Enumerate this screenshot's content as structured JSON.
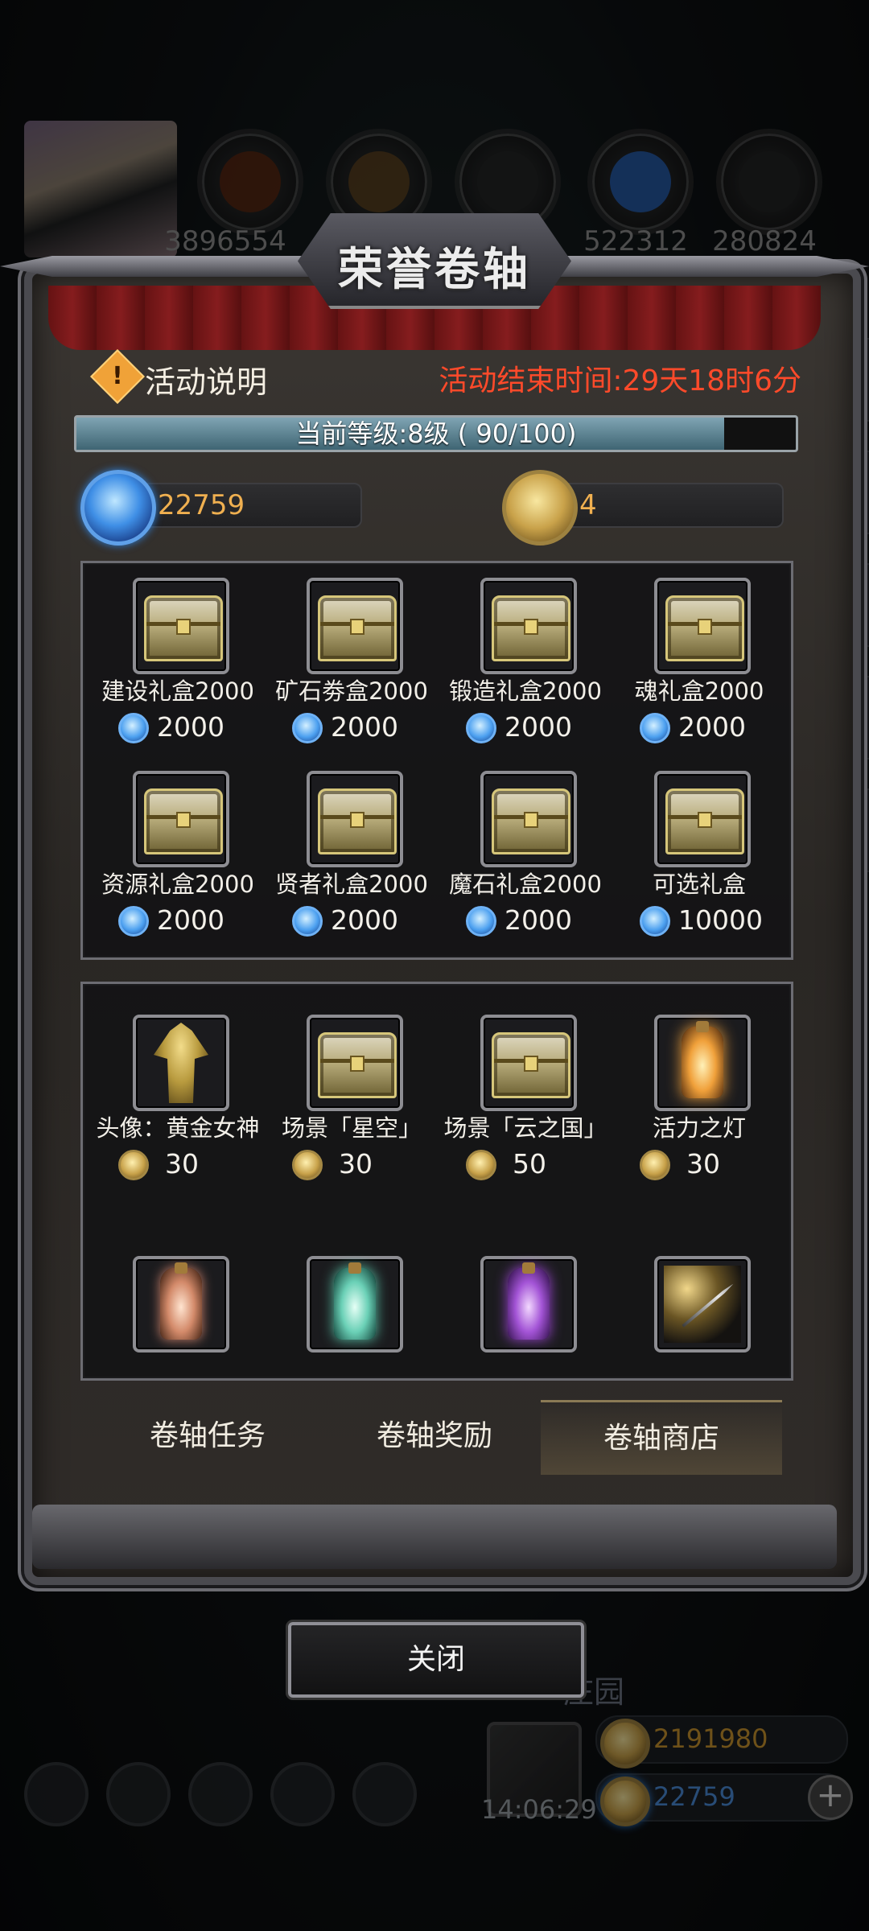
{
  "background": {
    "resource_values": [
      "3896554",
      "522312",
      "280824"
    ],
    "estate_label": "庄园",
    "clock": "14:06:29",
    "gold_amount": "2191980",
    "gem_amount": "22759",
    "plus_symbol": "+"
  },
  "modal": {
    "title": "荣誉卷轴",
    "info_label": "活动说明",
    "info_icon_glyph": "!",
    "end_time": "活动结束时间:29天18时6分",
    "level": {
      "text": "当前等级:8级 ( 90/100)",
      "current": 90,
      "max": 100
    },
    "currencies": [
      {
        "icon": "gem-icon",
        "value": "22759"
      },
      {
        "icon": "honor-coin-icon",
        "value": "4"
      }
    ],
    "gem_shop": [
      {
        "name": "建设礼盒2000",
        "icon": "chest-icon",
        "price": "2000"
      },
      {
        "name": "矿石劵盒2000",
        "icon": "chest-icon",
        "price": "2000"
      },
      {
        "name": "锻造礼盒2000",
        "icon": "chest-icon",
        "price": "2000"
      },
      {
        "name": "魂礼盒2000",
        "icon": "chest-icon",
        "price": "2000"
      },
      {
        "name": "资源礼盒2000",
        "icon": "chest-icon",
        "price": "2000"
      },
      {
        "name": "贤者礼盒2000",
        "icon": "chest-icon",
        "price": "2000"
      },
      {
        "name": "魔石礼盒2000",
        "icon": "chest-icon",
        "price": "2000"
      },
      {
        "name": "可选礼盒",
        "icon": "chest-icon",
        "price": "10000"
      }
    ],
    "coin_shop": [
      {
        "name": "头像：黄金女神",
        "icon": "golden-goddess-icon",
        "price": "30"
      },
      {
        "name": "场景「星空」",
        "icon": "chest-icon",
        "price": "30"
      },
      {
        "name": "场景「云之国」",
        "icon": "chest-icon",
        "price": "50"
      },
      {
        "name": "活力之灯",
        "icon": "vitality-lamp-icon",
        "price": "30"
      }
    ],
    "coin_shop_row2_icons": [
      "pink-lamp-icon",
      "cyan-lamp-icon",
      "purple-lamp-icon",
      "spear-icon"
    ],
    "tabs": [
      {
        "label": "卷轴任务",
        "active": false
      },
      {
        "label": "卷轴奖励",
        "active": false
      },
      {
        "label": "卷轴商店",
        "active": true
      }
    ],
    "close_label": "关闭"
  },
  "colors": {
    "end_time": "#ff4a2a",
    "currency_value": "#f0b050",
    "level_fill": "#5f8a9a"
  }
}
